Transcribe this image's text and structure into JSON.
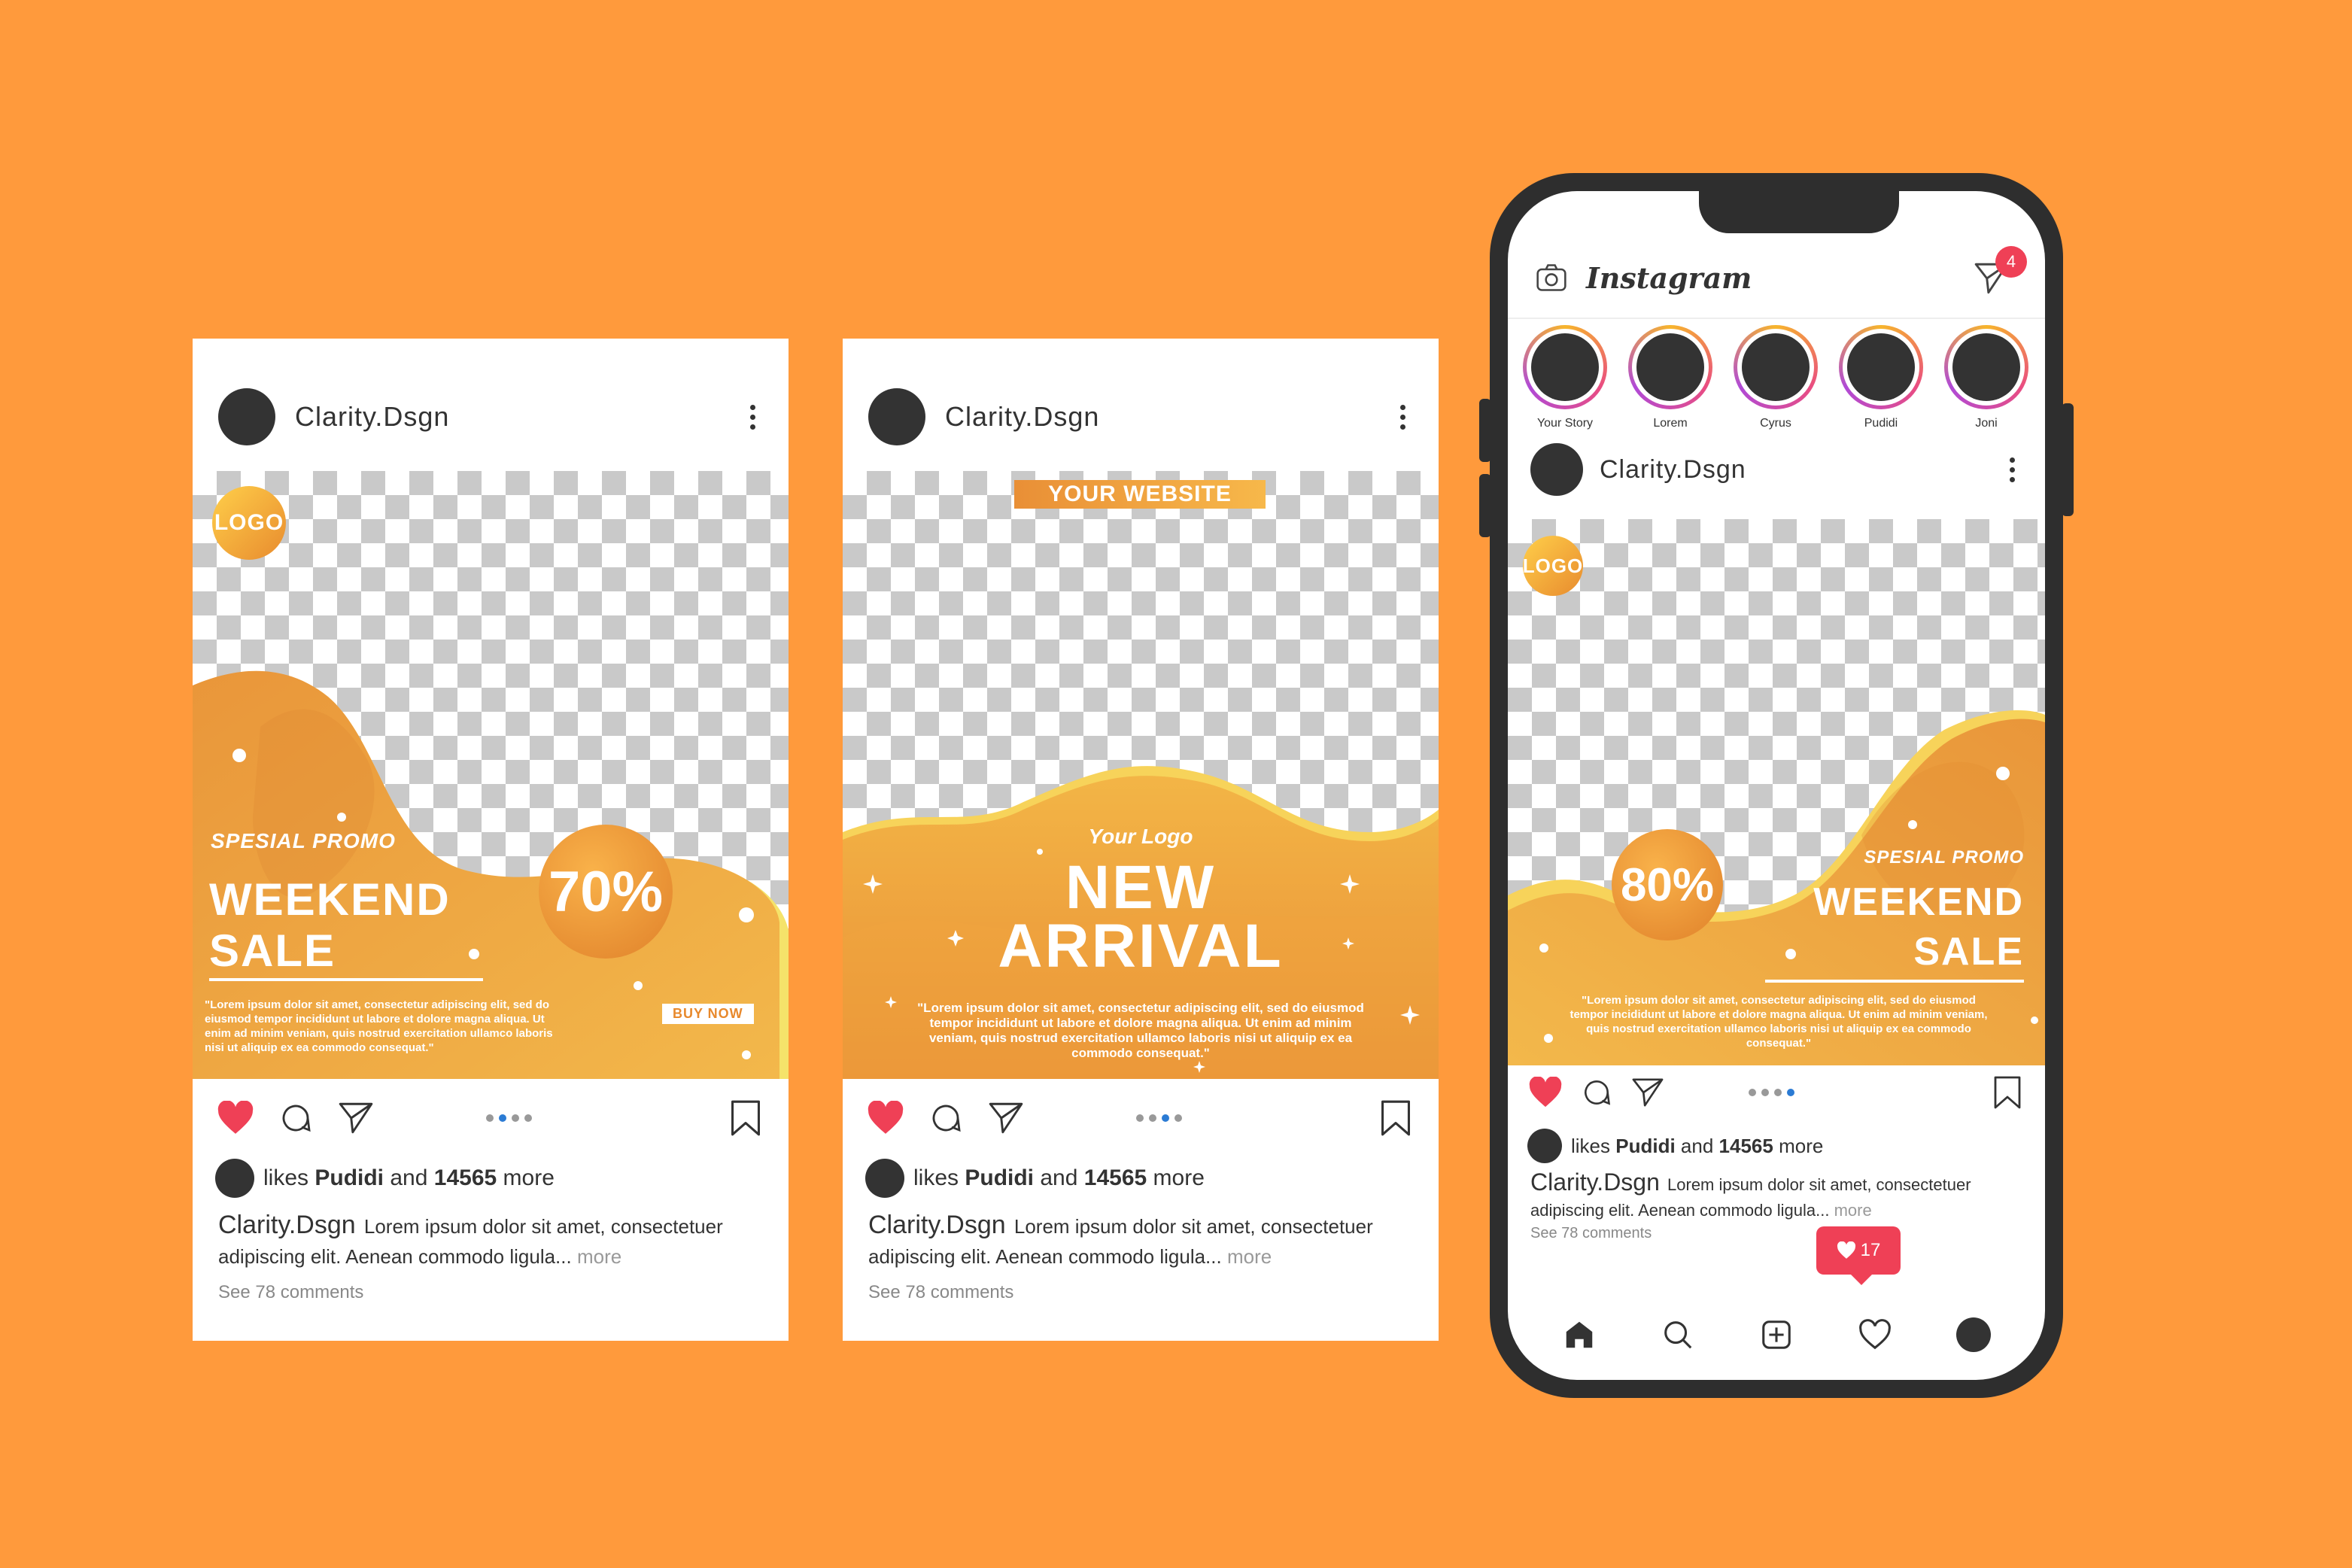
{
  "colors": {
    "background": "#FF9A3C",
    "accent_gold": "#F2A93B",
    "like_red": "#EF4056",
    "dot_active": "#2B7BD4"
  },
  "card1": {
    "username": "Clarity.Dsgn",
    "logo": "LOGO",
    "promo_small": "SPESIAL PROMO",
    "promo_line1": "WEEKEND",
    "promo_line2": "SALE",
    "discount": "70%",
    "lorem": "\"Lorem ipsum dolor sit amet, consectetur adipiscing elit, sed do eiusmod tempor incididunt ut labore et dolore magna aliqua. Ut enim ad minim veniam, quis nostrud exercitation ullamco laboris nisi ut aliquip ex ea commodo consequat.\"",
    "buy_now": "BUY NOW",
    "likes_prefix": "likes",
    "likes_user": "Pudidi",
    "likes_mid": "and",
    "likes_count": "14565",
    "likes_suffix": "more",
    "caption_user": "Clarity.Dsgn",
    "caption_text": "Lorem ipsum dolor sit amet, consectetuer adipiscing elit. Aenean commodo ligula...",
    "caption_more": "more",
    "comments": "See 78 comments",
    "icons": [
      "heart-icon",
      "comment-icon",
      "share-icon",
      "bookmark-icon"
    ]
  },
  "card2": {
    "username": "Clarity.Dsgn",
    "website": "YOUR WEBSITE",
    "your_logo": "Your Logo",
    "title_line1": "NEW",
    "title_line2": "ARRIVAL",
    "lorem": "\"Lorem ipsum dolor sit amet, consectetur adipiscing elit, sed do eiusmod tempor incididunt ut labore et dolore magna aliqua. Ut enim ad minim veniam, quis nostrud exercitation ullamco laboris nisi ut aliquip ex ea commodo consequat.\"",
    "likes_prefix": "likes",
    "likes_user": "Pudidi",
    "likes_mid": "and",
    "likes_count": "14565",
    "likes_suffix": "more",
    "caption_user": "Clarity.Dsgn",
    "caption_text": "Lorem ipsum dolor sit amet, consectetuer adipiscing elit. Aenean commodo ligula...",
    "caption_more": "more",
    "comments": "See 78 comments"
  },
  "phone": {
    "app_name": "Instagram",
    "dm_count": "4",
    "stories": [
      "Your Story",
      "Lorem",
      "Cyrus",
      "Pudidi",
      "Joni"
    ],
    "username": "Clarity.Dsgn",
    "logo": "LOGO",
    "discount": "80%",
    "promo_small": "SPESIAL PROMO",
    "promo_line1": "WEEKEND",
    "promo_line2": "SALE",
    "lorem": "\"Lorem ipsum dolor sit amet, consectetur adipiscing elit, sed do eiusmod tempor incididunt ut labore et dolore magna aliqua. Ut enim ad minim veniam, quis nostrud exercitation ullamco laboris nisi ut aliquip ex ea commodo consequat.\"",
    "likes_prefix": "likes",
    "likes_user": "Pudidi",
    "likes_mid": "and",
    "likes_count": "14565",
    "likes_suffix": "more",
    "caption_user": "Clarity.Dsgn",
    "caption_text": "Lorem ipsum dolor sit amet, consectetuer adipiscing elit. Aenean commodo ligula...",
    "caption_more": "more",
    "comments": "See 78 comments",
    "notification_count": "17",
    "tabs": [
      "home-icon",
      "search-icon",
      "add-post-icon",
      "activity-heart-icon",
      "profile-icon"
    ]
  }
}
